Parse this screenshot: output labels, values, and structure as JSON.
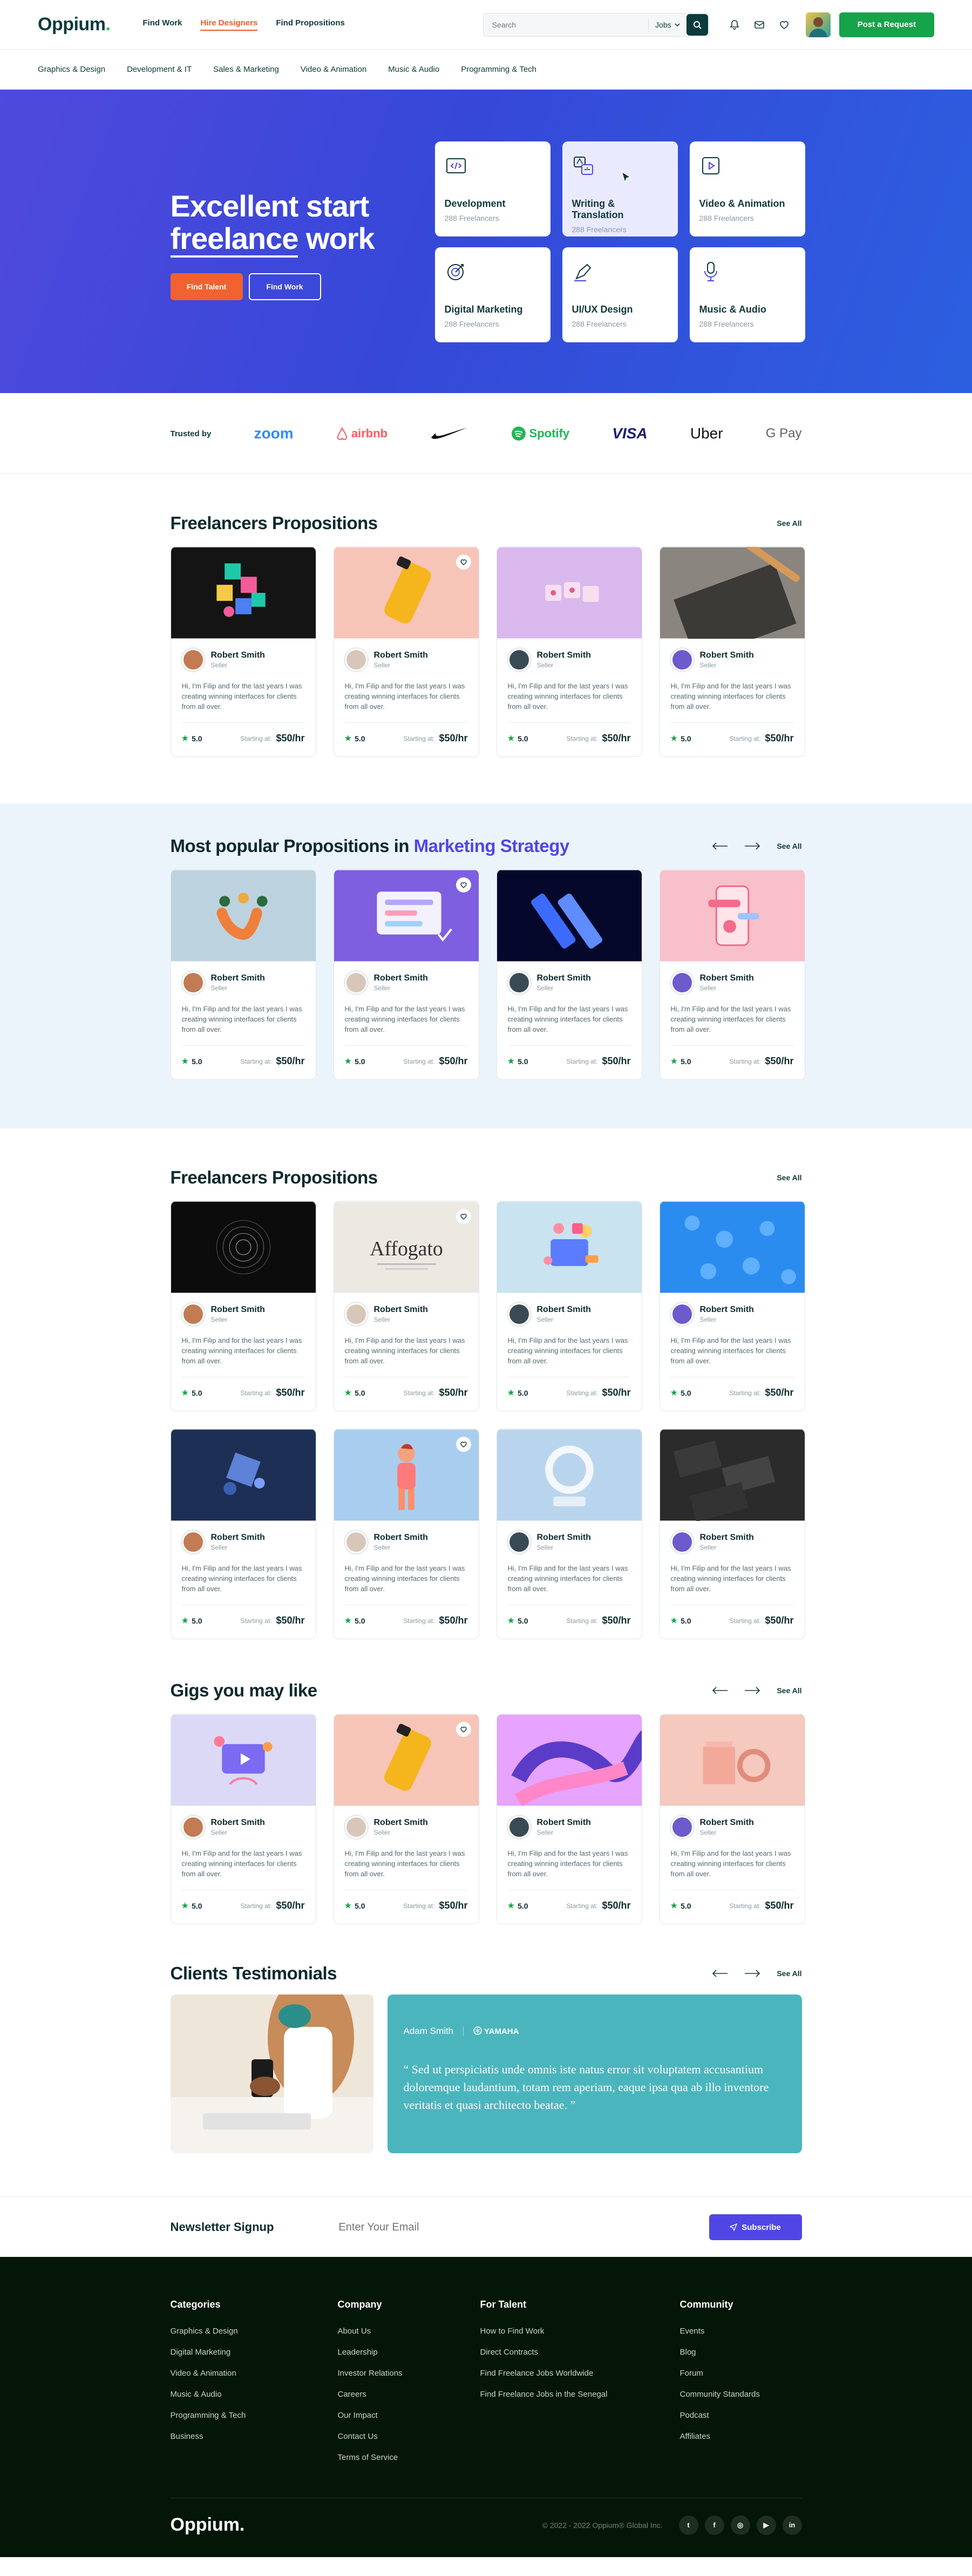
{
  "header": {
    "logo": "Oppium",
    "nav": [
      "Find Work",
      "Hire Designers",
      "Find Propositions"
    ],
    "search_placeholder": "Search",
    "search_scope": "Jobs",
    "post_button": "Post a Request"
  },
  "categories_bar": [
    "Graphics & Design",
    "Development & IT",
    "Sales & Marketing",
    "Video & Animation",
    "Music & Audio",
    "Programming & Tech"
  ],
  "hero": {
    "title_line1": "Excellent start",
    "title_word": "freelance",
    "title_rest": "work",
    "btn_talent": "Find Talent",
    "btn_work": "Find Work",
    "cards": [
      {
        "title": "Development",
        "count": "288 Freelancers",
        "icon": "code-icon"
      },
      {
        "title": "Writing & Translation",
        "count": "288 Freelancers",
        "icon": "translate-icon"
      },
      {
        "title": "Video & Animation",
        "count": "288 Freelancers",
        "icon": "video-icon"
      },
      {
        "title": "Digital Marketing",
        "count": "288 Freelancers",
        "icon": "target-icon"
      },
      {
        "title": "UI/UX Design",
        "count": "288 Freelancers",
        "icon": "pen-tool-icon"
      },
      {
        "title": "Music & Audio",
        "count": "288 Freelancers",
        "icon": "microphone-icon"
      }
    ]
  },
  "trusted": {
    "label": "Trusted by",
    "brands": [
      "zoom",
      "airbnb",
      "Nike",
      "Spotify",
      "VISA",
      "Uber",
      "G Pay"
    ]
  },
  "card_common": {
    "name": "Robert Smith",
    "role": "Seller",
    "desc": "Hi, I'm Filip and for the last years I was creating winning interfaces for clients from all over.",
    "rating": "5.0",
    "from": "Starting at:",
    "price": "$50/hr"
  },
  "sections": [
    {
      "title": "Freelancers Propositions",
      "title_accent": "",
      "see_all": "See All",
      "arrows": false
    },
    {
      "title": "Most popular Propositions in ",
      "title_accent": "Marketing Strategy",
      "see_all": "See All",
      "arrows": true
    },
    {
      "title": "Freelancers Propositions",
      "title_accent": "",
      "see_all": "See All",
      "arrows": false
    },
    {
      "title": "Gigs you may like",
      "title_accent": "",
      "see_all": "See All",
      "arrows": true
    }
  ],
  "thumb_text": {
    "affogato": "Affogato"
  },
  "testimonials": {
    "title": "Clients Testimonials",
    "see_all": "See All",
    "name": "Adam Smith",
    "company": "YAMAHA",
    "quote": "“ Sed ut perspiciatis unde omnis iste natus error sit voluptatem accusantium doloremque laudantium, totam rem aperiam, eaque ipsa qua ab illo inventore veritatis et quasi architecto beatae. ”"
  },
  "newsletter": {
    "title": "Newsletter Signup",
    "placeholder": "Enter Your Email",
    "button": "Subscribe"
  },
  "footer": {
    "columns": [
      {
        "title": "Categories",
        "items": [
          "Graphics & Design",
          "Digital Marketing",
          "Video & Animation",
          "Music & Audio",
          "Programming & Tech",
          "Business"
        ]
      },
      {
        "title": "Company",
        "items": [
          "About Us",
          "Leadership",
          "Investor Relations",
          "Careers",
          "Our Impact",
          "Contact Us",
          "Terms of Service"
        ]
      },
      {
        "title": "For Talent",
        "items": [
          "How to Find Work",
          "Direct Contracts",
          "Find Freelance Jobs Worldwide",
          "Find Freelance Jobs in the Senegal"
        ]
      },
      {
        "title": "Community",
        "items": [
          "Events",
          "Blog",
          "Forum",
          "Community Standards",
          "Podcast",
          "Affiliates"
        ]
      }
    ],
    "logo": "Oppium.",
    "copyright": "© 2022 - 2022 Oppium® Global Inc.",
    "social": [
      {
        "icon": "twitter-icon",
        "glyph": "t"
      },
      {
        "icon": "facebook-icon",
        "glyph": "f"
      },
      {
        "icon": "instagram-icon",
        "glyph": "◎"
      },
      {
        "icon": "youtube-icon",
        "glyph": "▶"
      },
      {
        "icon": "linkedin-icon",
        "glyph": "in"
      }
    ]
  },
  "colors": {
    "accent": "#4f46e5",
    "brand": "#0b3b3c",
    "cta": "#16a34a",
    "orange": "#f05a28",
    "footer": "#031608"
  }
}
